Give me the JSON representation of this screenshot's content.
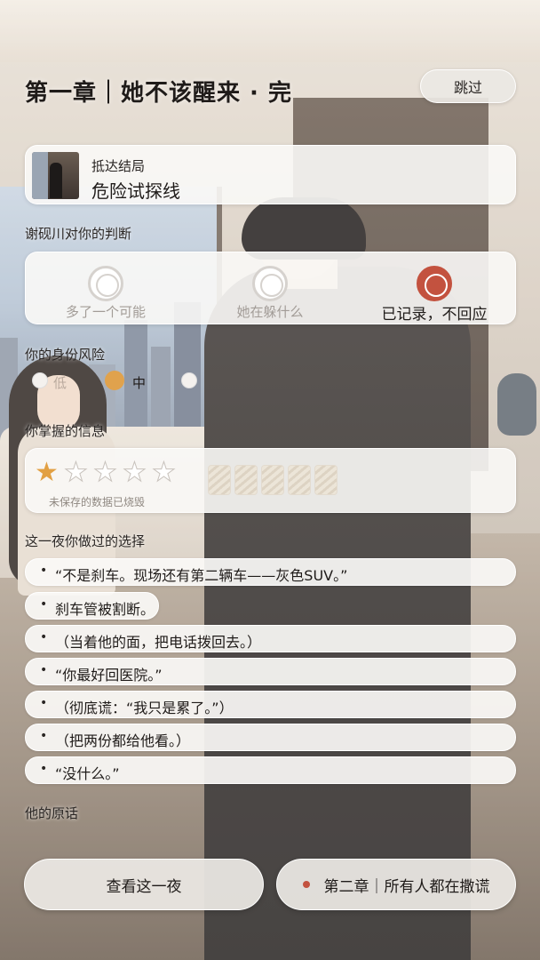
{
  "header": {
    "title": "第一章｜她不该醒来 · 完",
    "skip_label": "跳过"
  },
  "ending": {
    "label": "抵达结局",
    "name": "危险试探线"
  },
  "judgment": {
    "heading": "谢砚川对你的判断",
    "options": [
      {
        "label": "多了一个可能",
        "selected": false
      },
      {
        "label": "她在躲什么",
        "selected": false
      },
      {
        "label": "已记录，不回应",
        "selected": true
      }
    ],
    "accent_color": "#c3523f"
  },
  "risk": {
    "heading": "你的身份风险",
    "levels": [
      {
        "label": "低",
        "active": false
      },
      {
        "label": "中",
        "active": true
      },
      {
        "label": "",
        "active": false
      }
    ],
    "accent_color": "#e0a24d"
  },
  "info": {
    "heading": "你掌握的信息",
    "stars_total": 5,
    "stars_filled": 1,
    "slots": 5,
    "note": "未保存的数据已烧毁"
  },
  "choices": {
    "heading": "这一夜你做过的选择",
    "bullet": "•",
    "items": [
      "“不是刹车。现场还有第二辆车——灰色SUV。”",
      "刹车管被割断。",
      "（当着他的面，把电话拨回去。）",
      "“你最好回医院。”",
      "（彻底谎：“我只是累了。”）",
      "（把两份都给他看。）",
      "“没什么。”"
    ]
  },
  "quote": {
    "heading": "他的原话"
  },
  "buttons": {
    "review_label": "查看这一夜",
    "next_label": "第二章｜所有人都在撒谎"
  }
}
